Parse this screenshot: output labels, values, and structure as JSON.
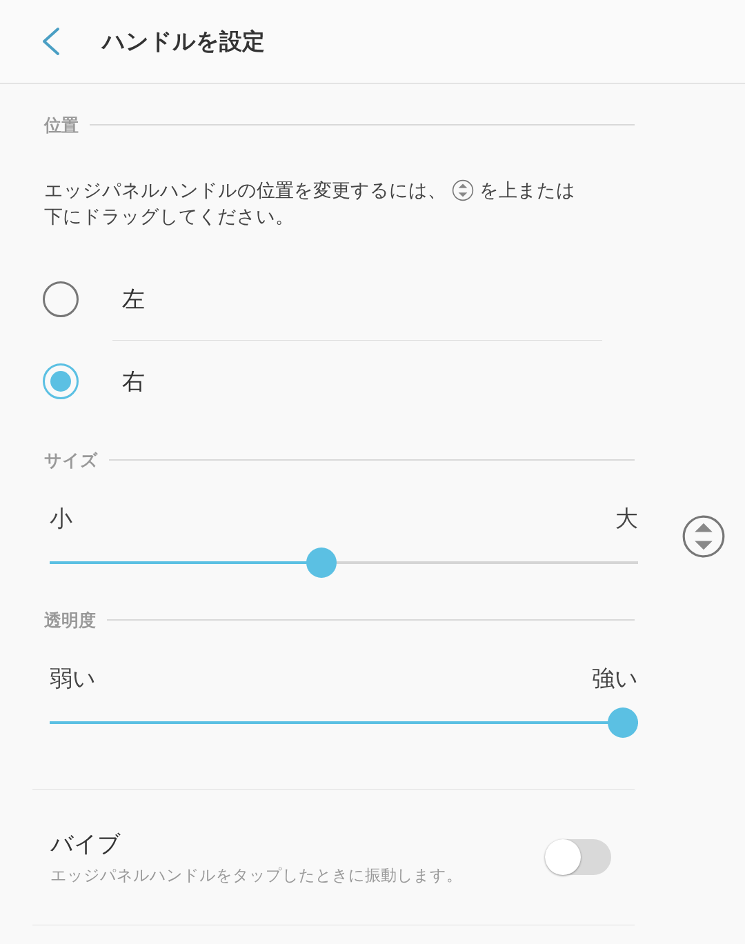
{
  "header": {
    "title": "ハンドルを設定"
  },
  "position": {
    "heading": "位置",
    "description_before": "エッジパネルハンドルの位置を変更するには、",
    "description_after": "を上または",
    "description_line_2": "下にドラッグしてください。",
    "options": [
      {
        "label": "左",
        "selected": false
      },
      {
        "label": "右",
        "selected": true
      }
    ]
  },
  "size": {
    "heading": "サイズ",
    "min_label": "小",
    "max_label": "大",
    "level": 0.46
  },
  "transparency": {
    "heading": "透明度",
    "min_label": "弱い",
    "max_label": "強い",
    "level": 1.0
  },
  "vibrate": {
    "title": "バイブ",
    "subtitle": "エッジパネルハンドルをタップしたときに振動します。",
    "on": false
  }
}
